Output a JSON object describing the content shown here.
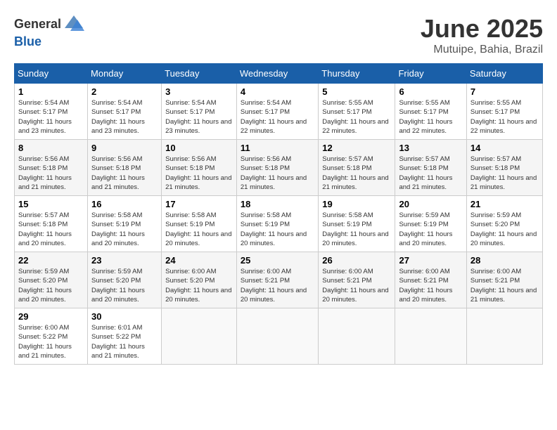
{
  "header": {
    "logo": {
      "general": "General",
      "blue": "Blue"
    },
    "title": "June 2025",
    "location": "Mutuipe, Bahia, Brazil"
  },
  "weekdays": [
    "Sunday",
    "Monday",
    "Tuesday",
    "Wednesday",
    "Thursday",
    "Friday",
    "Saturday"
  ],
  "weeks": [
    [
      {
        "day": 1,
        "sunrise": "5:54 AM",
        "sunset": "5:17 PM",
        "daylight": "11 hours and 23 minutes."
      },
      {
        "day": 2,
        "sunrise": "5:54 AM",
        "sunset": "5:17 PM",
        "daylight": "11 hours and 23 minutes."
      },
      {
        "day": 3,
        "sunrise": "5:54 AM",
        "sunset": "5:17 PM",
        "daylight": "11 hours and 23 minutes."
      },
      {
        "day": 4,
        "sunrise": "5:54 AM",
        "sunset": "5:17 PM",
        "daylight": "11 hours and 22 minutes."
      },
      {
        "day": 5,
        "sunrise": "5:55 AM",
        "sunset": "5:17 PM",
        "daylight": "11 hours and 22 minutes."
      },
      {
        "day": 6,
        "sunrise": "5:55 AM",
        "sunset": "5:17 PM",
        "daylight": "11 hours and 22 minutes."
      },
      {
        "day": 7,
        "sunrise": "5:55 AM",
        "sunset": "5:17 PM",
        "daylight": "11 hours and 22 minutes."
      }
    ],
    [
      {
        "day": 8,
        "sunrise": "5:56 AM",
        "sunset": "5:18 PM",
        "daylight": "11 hours and 21 minutes."
      },
      {
        "day": 9,
        "sunrise": "5:56 AM",
        "sunset": "5:18 PM",
        "daylight": "11 hours and 21 minutes."
      },
      {
        "day": 10,
        "sunrise": "5:56 AM",
        "sunset": "5:18 PM",
        "daylight": "11 hours and 21 minutes."
      },
      {
        "day": 11,
        "sunrise": "5:56 AM",
        "sunset": "5:18 PM",
        "daylight": "11 hours and 21 minutes."
      },
      {
        "day": 12,
        "sunrise": "5:57 AM",
        "sunset": "5:18 PM",
        "daylight": "11 hours and 21 minutes."
      },
      {
        "day": 13,
        "sunrise": "5:57 AM",
        "sunset": "5:18 PM",
        "daylight": "11 hours and 21 minutes."
      },
      {
        "day": 14,
        "sunrise": "5:57 AM",
        "sunset": "5:18 PM",
        "daylight": "11 hours and 21 minutes."
      }
    ],
    [
      {
        "day": 15,
        "sunrise": "5:57 AM",
        "sunset": "5:18 PM",
        "daylight": "11 hours and 20 minutes."
      },
      {
        "day": 16,
        "sunrise": "5:58 AM",
        "sunset": "5:19 PM",
        "daylight": "11 hours and 20 minutes."
      },
      {
        "day": 17,
        "sunrise": "5:58 AM",
        "sunset": "5:19 PM",
        "daylight": "11 hours and 20 minutes."
      },
      {
        "day": 18,
        "sunrise": "5:58 AM",
        "sunset": "5:19 PM",
        "daylight": "11 hours and 20 minutes."
      },
      {
        "day": 19,
        "sunrise": "5:58 AM",
        "sunset": "5:19 PM",
        "daylight": "11 hours and 20 minutes."
      },
      {
        "day": 20,
        "sunrise": "5:59 AM",
        "sunset": "5:19 PM",
        "daylight": "11 hours and 20 minutes."
      },
      {
        "day": 21,
        "sunrise": "5:59 AM",
        "sunset": "5:20 PM",
        "daylight": "11 hours and 20 minutes."
      }
    ],
    [
      {
        "day": 22,
        "sunrise": "5:59 AM",
        "sunset": "5:20 PM",
        "daylight": "11 hours and 20 minutes."
      },
      {
        "day": 23,
        "sunrise": "5:59 AM",
        "sunset": "5:20 PM",
        "daylight": "11 hours and 20 minutes."
      },
      {
        "day": 24,
        "sunrise": "6:00 AM",
        "sunset": "5:20 PM",
        "daylight": "11 hours and 20 minutes."
      },
      {
        "day": 25,
        "sunrise": "6:00 AM",
        "sunset": "5:21 PM",
        "daylight": "11 hours and 20 minutes."
      },
      {
        "day": 26,
        "sunrise": "6:00 AM",
        "sunset": "5:21 PM",
        "daylight": "11 hours and 20 minutes."
      },
      {
        "day": 27,
        "sunrise": "6:00 AM",
        "sunset": "5:21 PM",
        "daylight": "11 hours and 20 minutes."
      },
      {
        "day": 28,
        "sunrise": "6:00 AM",
        "sunset": "5:21 PM",
        "daylight": "11 hours and 21 minutes."
      }
    ],
    [
      {
        "day": 29,
        "sunrise": "6:00 AM",
        "sunset": "5:22 PM",
        "daylight": "11 hours and 21 minutes."
      },
      {
        "day": 30,
        "sunrise": "6:01 AM",
        "sunset": "5:22 PM",
        "daylight": "11 hours and 21 minutes."
      },
      null,
      null,
      null,
      null,
      null
    ]
  ]
}
